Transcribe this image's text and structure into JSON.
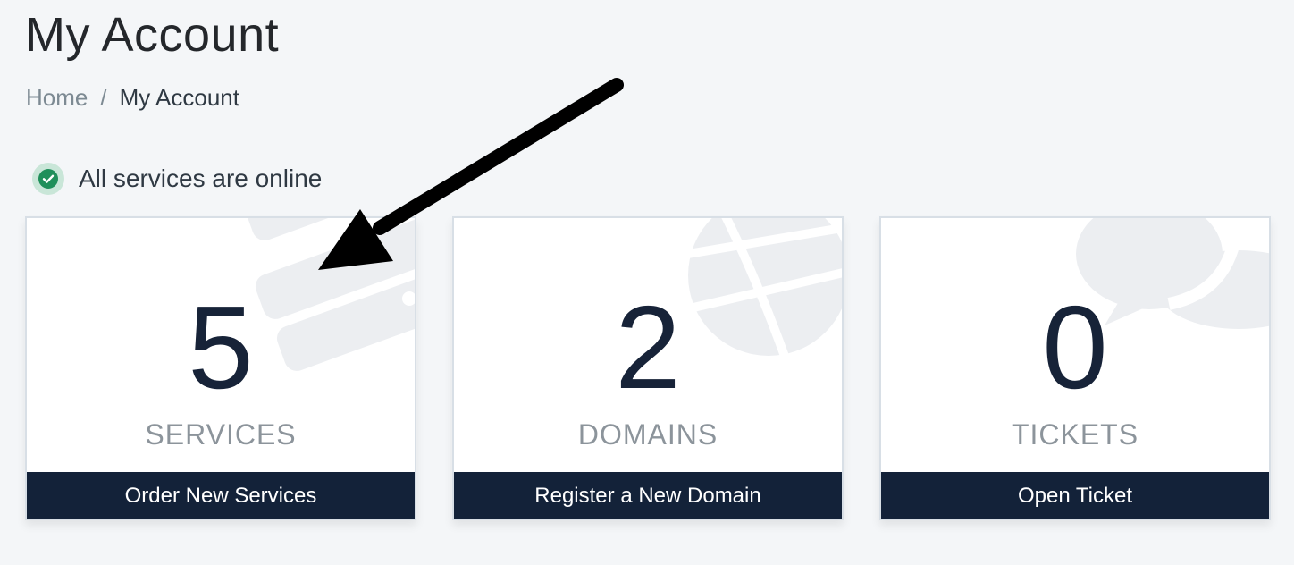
{
  "page": {
    "title": "My Account"
  },
  "breadcrumb": {
    "home": "Home",
    "separator": "/",
    "current": "My Account"
  },
  "status": {
    "text": "All services are online",
    "icon": "check-circle-icon",
    "color": "#1f8f5a"
  },
  "tiles": [
    {
      "count": "5",
      "label": "SERVICES",
      "button": "Order New Services",
      "icon": "server-icon"
    },
    {
      "count": "2",
      "label": "DOMAINS",
      "button": "Register a New Domain",
      "icon": "globe-icon"
    },
    {
      "count": "0",
      "label": "TICKETS",
      "button": "Open Ticket",
      "icon": "chat-bubble-icon"
    }
  ],
  "colors": {
    "background": "#f4f6f8",
    "tile_button": "#132239",
    "count_text": "#172338",
    "label_text": "#8c949b"
  }
}
